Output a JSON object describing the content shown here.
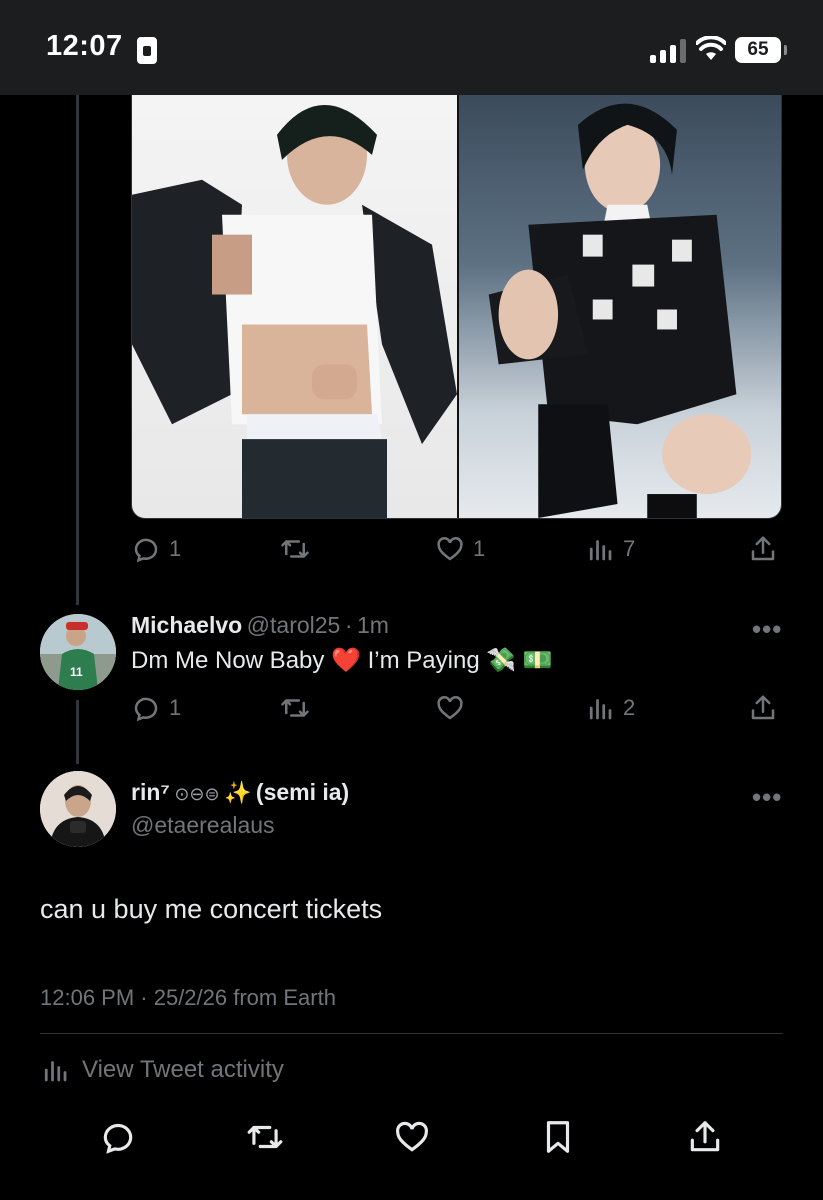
{
  "status_bar": {
    "time": "12:07",
    "battery": "65"
  },
  "media_actions": {
    "replies": "1",
    "likes": "1",
    "views": "7"
  },
  "reply": {
    "display_name": "Michaelvo",
    "handle": "@tarol25",
    "separator": "·",
    "time": "1m",
    "text_part1": "Dm Me Now Baby",
    "heart_emoji": "❤️",
    "text_part2": "I’m Paying",
    "money_emoji": "💸 💵",
    "replies": "1",
    "views": "2",
    "more": "•••"
  },
  "main_tweet": {
    "display_name": "rin⁷",
    "name_symbols": "⊙⊖⊜",
    "sparkle": "✨",
    "name_suffix": "(semi ia)",
    "handle": "@etaerealaus",
    "text": "can u buy me concert tickets",
    "meta": "12:06 PM · 25/2/26 from Earth",
    "more": "•••"
  },
  "activity": {
    "label": "View Tweet activity"
  },
  "colors": {
    "background": "#000000",
    "text": "#e7e9ea",
    "muted": "#71767b",
    "divider": "#2f3336"
  }
}
